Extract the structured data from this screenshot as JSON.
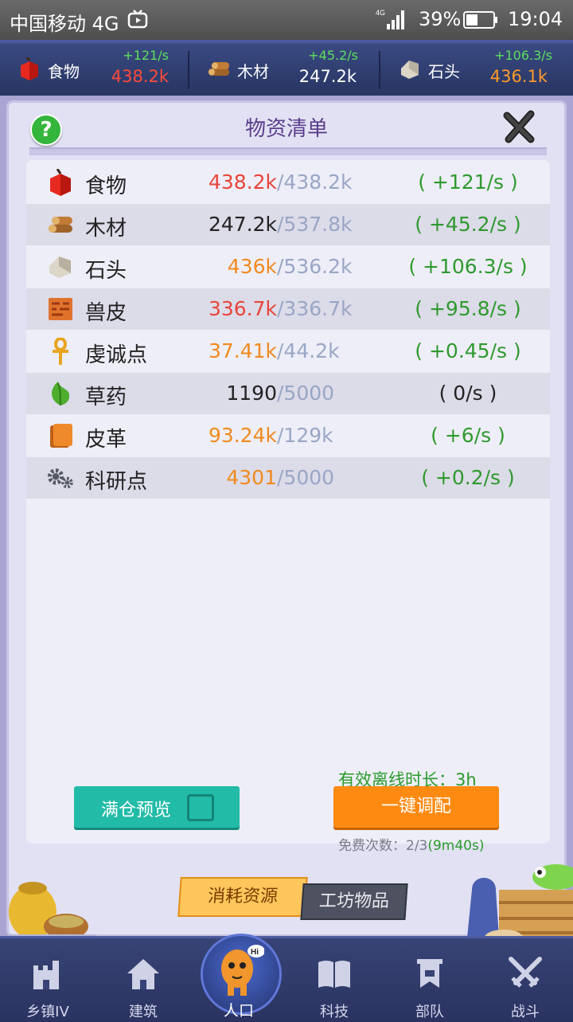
{
  "status_bar": {
    "carrier": "中国移动 4G",
    "battery": "39%",
    "time": "19:04"
  },
  "resource_bar": [
    {
      "name": "食物",
      "rate": "+121/s",
      "value": "438.2k",
      "value_color": "#ff4a3a",
      "icon": "apple-icon"
    },
    {
      "name": "木材",
      "rate": "+45.2/s",
      "value": "247.2k",
      "value_color": "#ffffff",
      "icon": "wood-icon"
    },
    {
      "name": "石头",
      "rate": "+106.3/s",
      "value": "436.1k",
      "value_color": "#ff9a2a",
      "icon": "stone-icon"
    }
  ],
  "dialog": {
    "title": "物资清单",
    "help": "?",
    "items": [
      {
        "name": "食物",
        "amount": "438.2k",
        "amount_color": "#e8453c",
        "cap": "/438.2k",
        "rate": "( +121/s )",
        "icon": "apple-icon"
      },
      {
        "name": "木材",
        "amount": "247.2k",
        "amount_color": "#222222",
        "cap": "/537.8k",
        "rate": "( +45.2/s )",
        "icon": "wood-icon"
      },
      {
        "name": "石头",
        "amount": "436k",
        "amount_color": "#f08a1e",
        "cap": "/536.2k",
        "rate": "( +106.3/s )",
        "icon": "stone-icon"
      },
      {
        "name": "兽皮",
        "amount": "336.7k",
        "amount_color": "#e8453c",
        "cap": "/336.7k",
        "rate": "( +95.8/s )",
        "icon": "hide-icon"
      },
      {
        "name": "虔诚点",
        "amount": "37.41k",
        "amount_color": "#f08a1e",
        "cap": "/44.2k",
        "rate": "( +0.45/s )",
        "icon": "ankh-icon"
      },
      {
        "name": "草药",
        "amount": "1190",
        "amount_color": "#222222",
        "cap": "/5000",
        "rate": "( 0/s )",
        "icon": "herb-icon"
      },
      {
        "name": "皮革",
        "amount": "93.24k",
        "amount_color": "#f08a1e",
        "cap": "/129k",
        "rate": "( +6/s )",
        "icon": "leather-icon"
      },
      {
        "name": "科研点",
        "amount": "4301",
        "amount_color": "#f08a1e",
        "cap": "/5000",
        "rate": "( +0.2/s )",
        "icon": "gears-icon"
      }
    ],
    "offline_label": "有效离线时长：3h",
    "preview_button": "满仓预览",
    "assign_button": "一键调配",
    "free_count_label": "免费次数：2/3",
    "free_count_timer": "(9m40s)",
    "tabs": [
      "消耗资源",
      "工坊物品"
    ]
  },
  "bottom_nav": [
    {
      "label": "乡镇IV",
      "icon": "castle-icon"
    },
    {
      "label": "建筑",
      "icon": "house-icon"
    },
    {
      "label": "人口",
      "icon": "villager-icon",
      "badge": "Hi"
    },
    {
      "label": "科技",
      "icon": "book-icon"
    },
    {
      "label": "部队",
      "icon": "banner-icon"
    },
    {
      "label": "战斗",
      "icon": "swords-icon"
    }
  ]
}
